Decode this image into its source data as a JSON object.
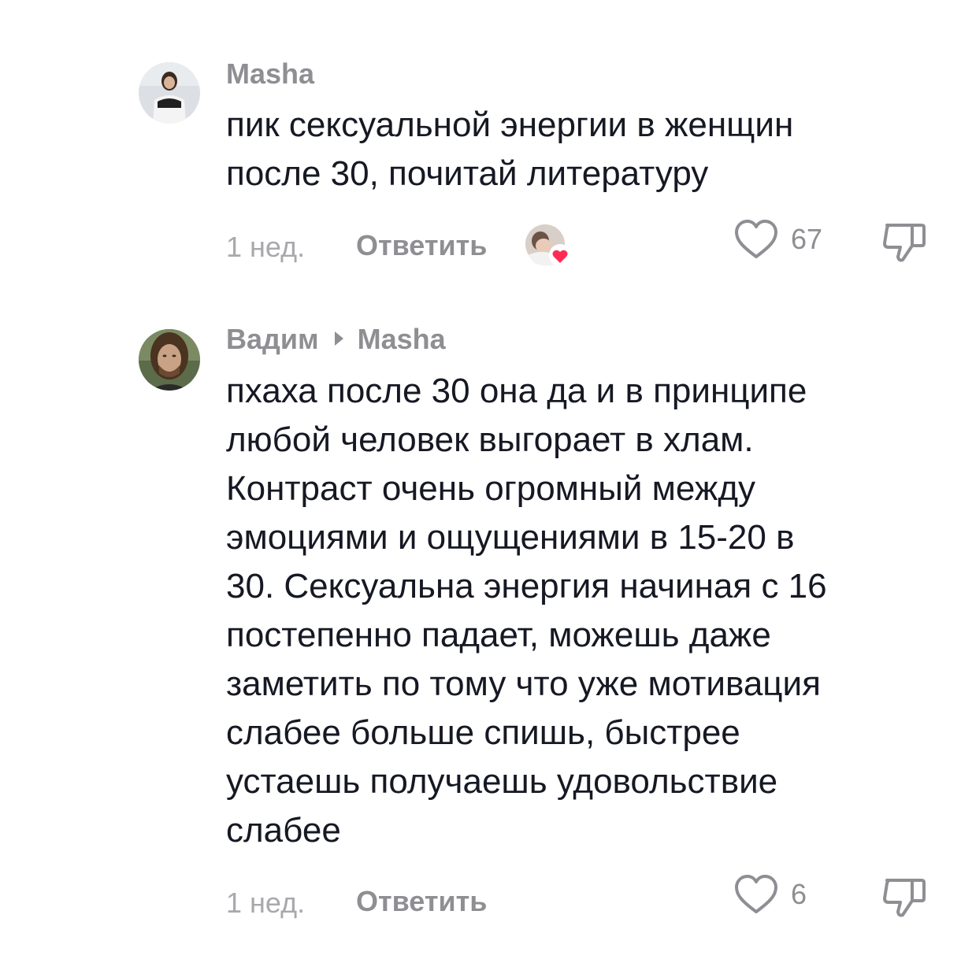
{
  "comments": [
    {
      "author": "Masha",
      "reply_to": "",
      "text_lines": [
        "пик сексуальной энергии в женщин",
        "после 30, почитай литературу"
      ],
      "time": "1 нед.",
      "reply_label": "Ответить",
      "likes": "67",
      "creator_liked": true
    },
    {
      "author": "Вадим",
      "reply_to": "Masha",
      "text_lines": [
        "пхаха после 30 она да и в принципе",
        "любой человек выгорает в хлам.",
        "Контраст очень огромный между",
        "эмоциями и ощущениями в 15-20 в",
        "30. Сексуальна энергия начиная с 16",
        "постепенно падает, можешь даже",
        "заметить по тому что уже мотивация",
        "слабее больше спишь, быстрее",
        "устаешь получаешь удовольствие",
        "слабее"
      ],
      "time": "1 нед.",
      "reply_label": "Ответить",
      "likes": "6",
      "creator_liked": false
    }
  ],
  "colors": {
    "text": "#161823",
    "muted": "#8e8e93",
    "heart_badge": "#fe2c55"
  },
  "icons": [
    "heart-icon",
    "dislike-icon",
    "creator-liked-badge"
  ]
}
